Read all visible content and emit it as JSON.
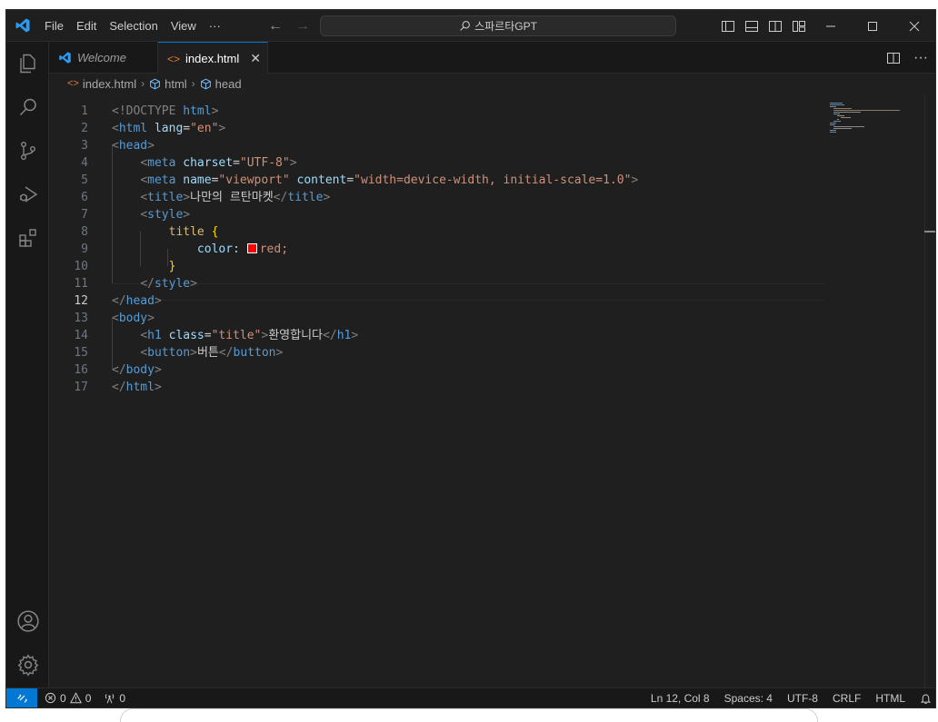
{
  "menu": [
    "File",
    "Edit",
    "Selection",
    "View",
    "···"
  ],
  "command_center": {
    "label": "스파르타GPT"
  },
  "tabs": [
    {
      "label": "Welcome"
    },
    {
      "label": "index.html",
      "close": "✕"
    }
  ],
  "breadcrumb": [
    "index.html",
    "html",
    "head"
  ],
  "code_lines": [
    {
      "n": "1"
    },
    {
      "n": "2"
    },
    {
      "n": "3"
    },
    {
      "n": "4"
    },
    {
      "n": "5"
    },
    {
      "n": "6"
    },
    {
      "n": "7"
    },
    {
      "n": "8"
    },
    {
      "n": "9"
    },
    {
      "n": "10"
    },
    {
      "n": "11"
    },
    {
      "n": "12"
    },
    {
      "n": "13"
    },
    {
      "n": "14"
    },
    {
      "n": "15"
    },
    {
      "n": "16"
    },
    {
      "n": "17"
    }
  ],
  "code": {
    "doctype": "<!DOCTYPE",
    "html_kw": "html",
    "html_open": "html",
    "lang_attr": "lang",
    "lang_val": "\"en\"",
    "head": "head",
    "meta": "meta",
    "charset_attr": "charset",
    "charset_val": "\"UTF-8\"",
    "name_attr": "name",
    "name_val": "\"viewport\"",
    "content_attr": "content",
    "content_val": "\"width=device-width, initial-scale=1.0\"",
    "title_tag": "title",
    "title_text": "나만의 르탄마켓",
    "style_tag": "style",
    "selector": "title",
    "prop": "color:",
    "prop_val": "red;",
    "body": "body",
    "h1": "h1",
    "class_attr": "class",
    "class_val": "\"title\"",
    "h1_text": "환영합니다",
    "button": "button",
    "button_text": "버튼"
  },
  "status": {
    "errors": "0",
    "warnings": "0",
    "ports": "0",
    "position": "Ln 12, Col 8",
    "spaces": "Spaces: 4",
    "encoding": "UTF-8",
    "eol": "CRLF",
    "language": "HTML"
  },
  "colors": {
    "accent": "#0078d4",
    "background": "#1f1f1f",
    "swatch": "#ff0000"
  },
  "icons": [
    "vscode-logo-icon",
    "explorer-icon",
    "search-icon",
    "source-control-icon",
    "run-debug-icon",
    "extensions-icon",
    "account-icon",
    "manage-gear-icon",
    "remote-icon",
    "bell-icon"
  ]
}
